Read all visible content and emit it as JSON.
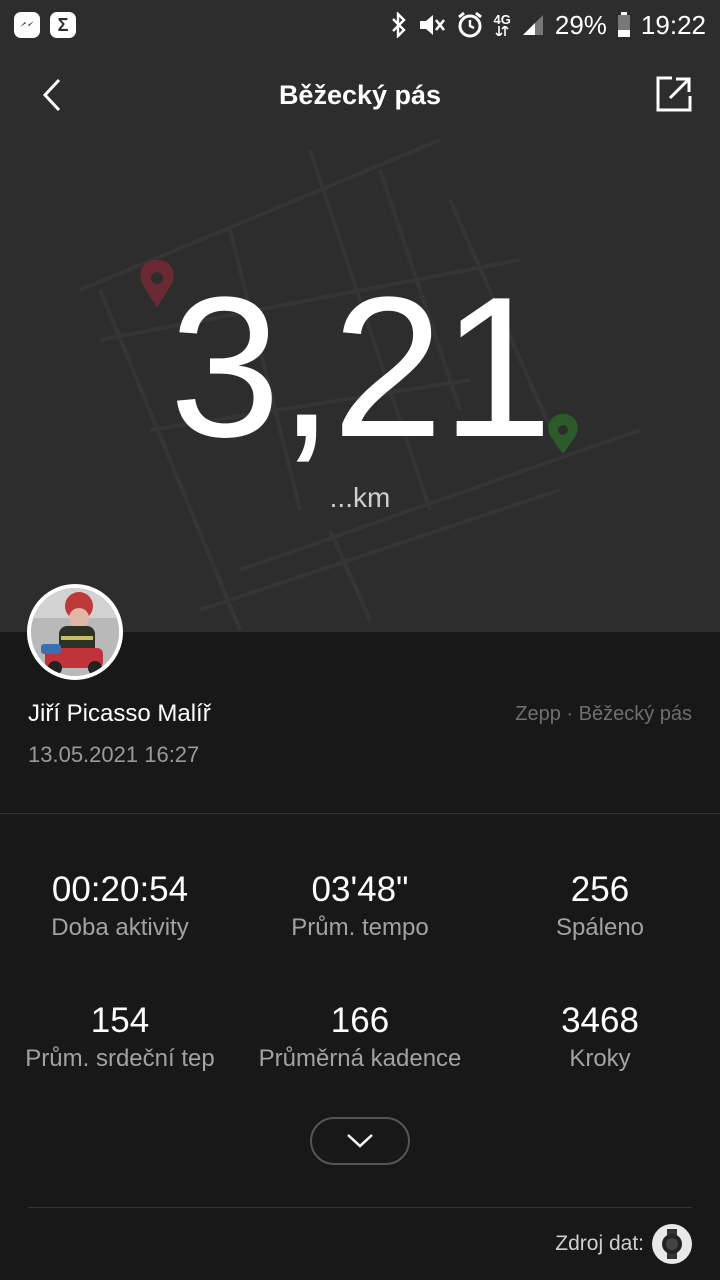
{
  "status_bar": {
    "battery": "29%",
    "time": "19:22",
    "network": "4G",
    "left_icons": [
      "messenger-icon",
      "sigma-app-icon"
    ],
    "right_icons": [
      "bluetooth-icon",
      "mute-icon",
      "alarm-icon",
      "signal-icon",
      "battery-icon"
    ]
  },
  "header": {
    "title": "Běžecký pás"
  },
  "hero": {
    "distance": "3,21",
    "unit": "...km"
  },
  "user": {
    "name": "Jiří Picasso Malíř",
    "datetime": "13.05.2021 16:27",
    "source": "Zepp · Běžecký pás"
  },
  "stats": [
    {
      "value": "00:20:54",
      "label": "Doba aktivity"
    },
    {
      "value": "03'48\"",
      "label": "Prům. tempo"
    },
    {
      "value": "256",
      "label": "Spáleno"
    },
    {
      "value": "154",
      "label": "Prům. srdeční tep"
    },
    {
      "value": "166",
      "label": "Průměrná kadence"
    },
    {
      "value": "3468",
      "label": "Kroky"
    }
  ],
  "footer": {
    "data_source_label": "Zdroj dat:"
  },
  "colors": {
    "background": "#181818",
    "hero_background": "#2d2d2d",
    "start_pin": "#6b2a33",
    "end_pin": "#2d5a2a"
  }
}
